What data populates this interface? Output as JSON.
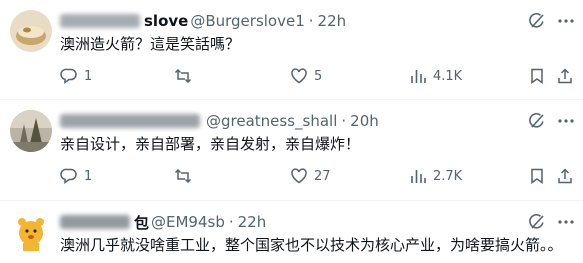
{
  "tweets": [
    {
      "name_tail": "slove",
      "handle": "@Burgerslove1",
      "time": "22h",
      "text": "澳洲造火箭？這是笑話嗎？",
      "replies": "1",
      "retweets": "",
      "likes": "5",
      "views": "4.1K"
    },
    {
      "name_tail": "",
      "handle": "@greatness_shall",
      "time": "20h",
      "text": "亲自设计，亲自部署，亲自发射，亲自爆炸！",
      "replies": "1",
      "retweets": "",
      "likes": "27",
      "views": "2.7K"
    },
    {
      "name_tail": "包",
      "handle": "@EM94sb",
      "time": "22h",
      "text": "澳洲几乎就没啥重工业，整个国家也不以技术为核心产业，为啥要搞火箭。。"
    }
  ],
  "separator": "·",
  "colors": {
    "text": "#0f1419",
    "secondary": "#536471",
    "divider": "#eff3f4"
  }
}
